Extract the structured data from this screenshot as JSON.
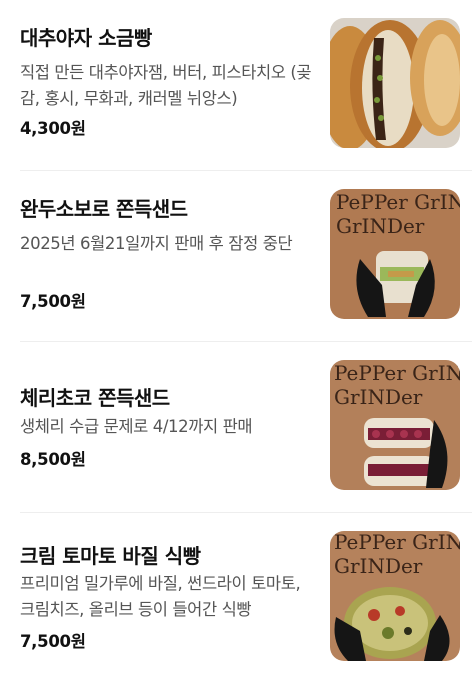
{
  "menu_items": [
    {
      "name": "대추야자 소금빵",
      "description": "직접 만든 대추야자잼, 버터, 피스타치오 (곶감, 홍시, 무화과, 캐러멜 뉘앙스)",
      "price": "4,300원",
      "image_icon": "salt-bread-photo"
    },
    {
      "name": "완두소보로 쫀득샌드",
      "description": "2025년 6월21일까지 판매 후 잠정 중단",
      "price": "7,500원",
      "image_icon": "pea-sandwich-photo",
      "image_sign_text": "PePPer GrINDer"
    },
    {
      "name": "체리초코 쫀득샌드",
      "description": "생체리 수급 문제로 4/12까지 판매",
      "price": "8,500원",
      "image_icon": "cherry-sandwich-photo",
      "image_sign_text": "PePPer GrINDer"
    },
    {
      "name": "크림 토마토 바질 식빵",
      "description": "프리미엄 밀가루에 바질, 썬드라이 토마토, 크림치즈, 올리브 등이 들어간 식빵",
      "price": "7,500원",
      "image_icon": "tomato-basil-bread-photo",
      "image_sign_text": "PePPer GrINDer"
    }
  ]
}
